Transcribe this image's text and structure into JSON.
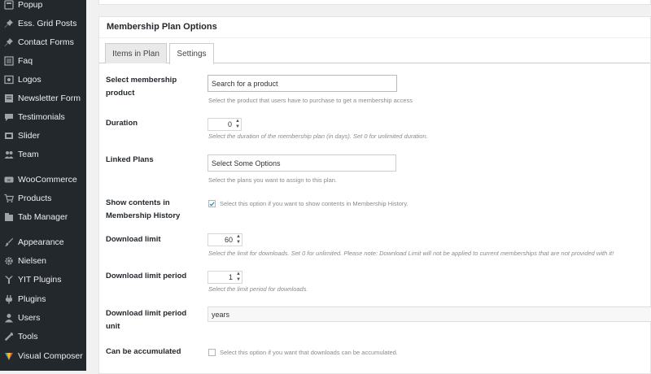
{
  "sidebar": {
    "items": [
      {
        "label": "Popup",
        "icon": "popup-icon"
      },
      {
        "label": "Ess. Grid Posts",
        "icon": "pin-icon"
      },
      {
        "label": "Contact Forms",
        "icon": "pin-icon"
      },
      {
        "label": "Faq",
        "icon": "list-icon"
      },
      {
        "label": "Logos",
        "icon": "image-icon"
      },
      {
        "label": "Newsletter Form",
        "icon": "newsletter-icon"
      },
      {
        "label": "Testimonials",
        "icon": "speech-bubble-icon"
      },
      {
        "label": "Slider",
        "icon": "slider-icon"
      },
      {
        "label": "Team",
        "icon": "team-icon"
      },
      {
        "label": "WooCommerce",
        "icon": "woocommerce-icon"
      },
      {
        "label": "Products",
        "icon": "cart-icon"
      },
      {
        "label": "Tab Manager",
        "icon": "tab-icon"
      },
      {
        "label": "Appearance",
        "icon": "paintbrush-icon"
      },
      {
        "label": "Nielsen",
        "icon": "gear-icon"
      },
      {
        "label": "YIT Plugins",
        "icon": "yit-icon"
      },
      {
        "label": "Plugins",
        "icon": "plug-icon"
      },
      {
        "label": "Users",
        "icon": "user-icon"
      },
      {
        "label": "Tools",
        "icon": "wrench-icon"
      },
      {
        "label": "Visual Composer",
        "icon": "visual-composer-icon"
      }
    ]
  },
  "metabox": {
    "title": "Membership Plan Options",
    "tabs": [
      {
        "label": "Items in Plan",
        "active": false
      },
      {
        "label": "Settings",
        "active": true
      }
    ]
  },
  "fields": {
    "product": {
      "label": "Select membership product",
      "placeholder": "Search for a product",
      "description": "Select the product that users have to purchase to get a membership access"
    },
    "duration": {
      "label": "Duration",
      "value": "0",
      "description": "Select the duration of the membership plan (in days). Set 0 for unlimited duration."
    },
    "linked_plans": {
      "label": "Linked Plans",
      "placeholder": "Select Some Options",
      "description": "Select the plans you want to assign to this plan."
    },
    "show_contents": {
      "label": "Show contents in Membership History",
      "checked": true,
      "check_label": "Select this option if you want to show contents in Membership History."
    },
    "download_limit": {
      "label": "Download limit",
      "value": "60",
      "description": "Select the limit for downloads. Set 0 for unlimited. Please note: Download Limit will not be applied to current memberships that are not provided with it!"
    },
    "download_limit_period": {
      "label": "Download limit period",
      "value": "1",
      "description": "Select the limit period for downloads."
    },
    "download_limit_period_unit": {
      "label": "Download limit period unit",
      "value": "years"
    },
    "accumulated": {
      "label": "Can be accumulated",
      "checked": false,
      "check_label": "Select this option if you want that downloads can be accumulated."
    }
  },
  "colors": {
    "sidebar_bg": "#23282d",
    "page_bg": "#f1f1f1",
    "checkbox_tick": "#1e8cbe"
  }
}
